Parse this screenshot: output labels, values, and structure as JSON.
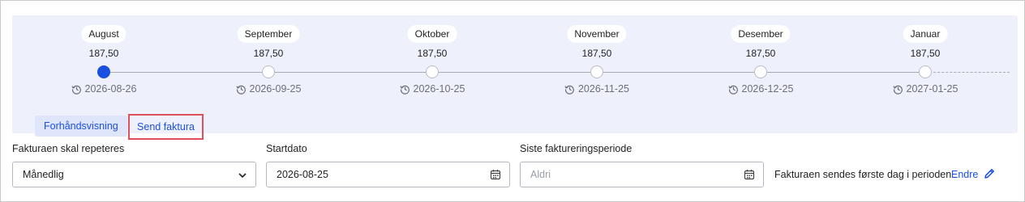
{
  "timeline": {
    "nodes": [
      {
        "month": "August",
        "amount": "187,50",
        "date": "2026-08-26",
        "active": true
      },
      {
        "month": "September",
        "amount": "187,50",
        "date": "2026-09-25",
        "active": false
      },
      {
        "month": "Oktober",
        "amount": "187,50",
        "date": "2026-10-25",
        "active": false
      },
      {
        "month": "November",
        "amount": "187,50",
        "date": "2026-11-25",
        "active": false
      },
      {
        "month": "Desember",
        "amount": "187,50",
        "date": "2026-12-25",
        "active": false
      },
      {
        "month": "Januar",
        "amount": "187,50",
        "date": "2027-01-25",
        "active": false
      }
    ],
    "icons": {
      "date": "clock-history-icon"
    }
  },
  "actions": {
    "preview_label": "Forhåndsvisning",
    "send_label": "Send faktura"
  },
  "form": {
    "repeat_label": "Fakturaen skal repeteres",
    "repeat_value": "Månedlig",
    "start_label": "Startdato",
    "start_value": "2026-08-25",
    "last_label": "Siste faktureringsperiode",
    "last_placeholder": "Aldri",
    "info_text": "Fakturaen sendes første dag i perioden",
    "edit_label": "Endre"
  },
  "colors": {
    "accent": "#1a4fe0",
    "highlight": "#e0505a",
    "panel": "#eef1fb"
  }
}
